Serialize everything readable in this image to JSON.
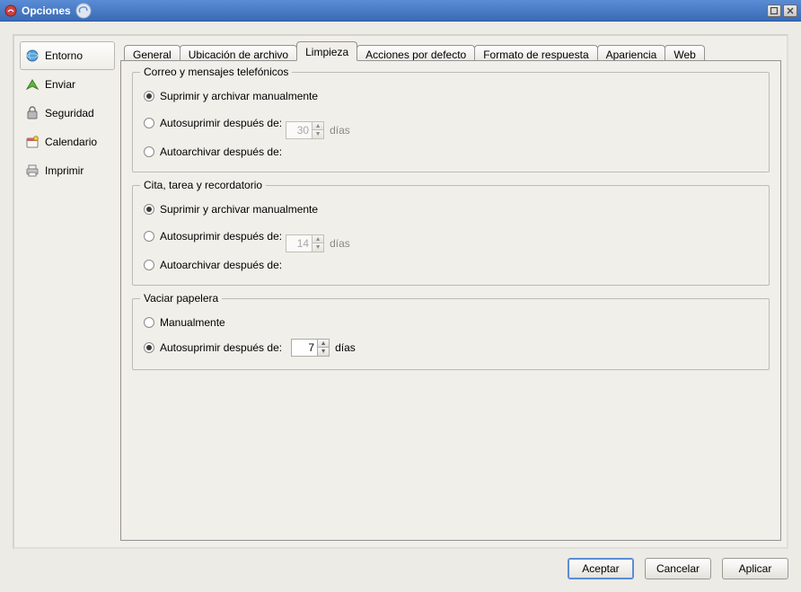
{
  "window": {
    "title": "Opciones"
  },
  "sidebar": {
    "items": [
      {
        "id": "entorno",
        "label": "Entorno",
        "selected": true
      },
      {
        "id": "enviar",
        "label": "Enviar",
        "selected": false
      },
      {
        "id": "seguridad",
        "label": "Seguridad",
        "selected": false
      },
      {
        "id": "calendario",
        "label": "Calendario",
        "selected": false
      },
      {
        "id": "imprimir",
        "label": "Imprimir",
        "selected": false
      }
    ]
  },
  "tabs": {
    "items": [
      {
        "id": "general",
        "label": "General"
      },
      {
        "id": "ubicacion",
        "label": "Ubicación de archivo"
      },
      {
        "id": "limpieza",
        "label": "Limpieza"
      },
      {
        "id": "acciones",
        "label": "Acciones por defecto"
      },
      {
        "id": "formato",
        "label": "Formato de respuesta"
      },
      {
        "id": "apariencia",
        "label": "Apariencia"
      },
      {
        "id": "web",
        "label": "Web"
      }
    ],
    "active": "limpieza"
  },
  "groups": {
    "correo": {
      "title": "Correo y mensajes telefónicos",
      "opt_manual": "Suprimir y archivar manualmente",
      "opt_autosuprimir": "Autosuprimir después de:",
      "opt_autoarchivar": "Autoarchivar después de:",
      "days_value": "30",
      "days_unit": "días",
      "selected": "manual"
    },
    "cita": {
      "title": "Cita, tarea y recordatorio",
      "opt_manual": "Suprimir y archivar manualmente",
      "opt_autosuprimir": "Autosuprimir después de:",
      "opt_autoarchivar": "Autoarchivar después de:",
      "days_value": "14",
      "days_unit": "días",
      "selected": "manual"
    },
    "papelera": {
      "title": "Vaciar papelera",
      "opt_manual": "Manualmente",
      "opt_autosuprimir": "Autosuprimir después de:",
      "days_value": "7",
      "days_unit": "días",
      "selected": "autosuprimir"
    }
  },
  "buttons": {
    "ok": "Aceptar",
    "cancel": "Cancelar",
    "apply": "Aplicar"
  }
}
